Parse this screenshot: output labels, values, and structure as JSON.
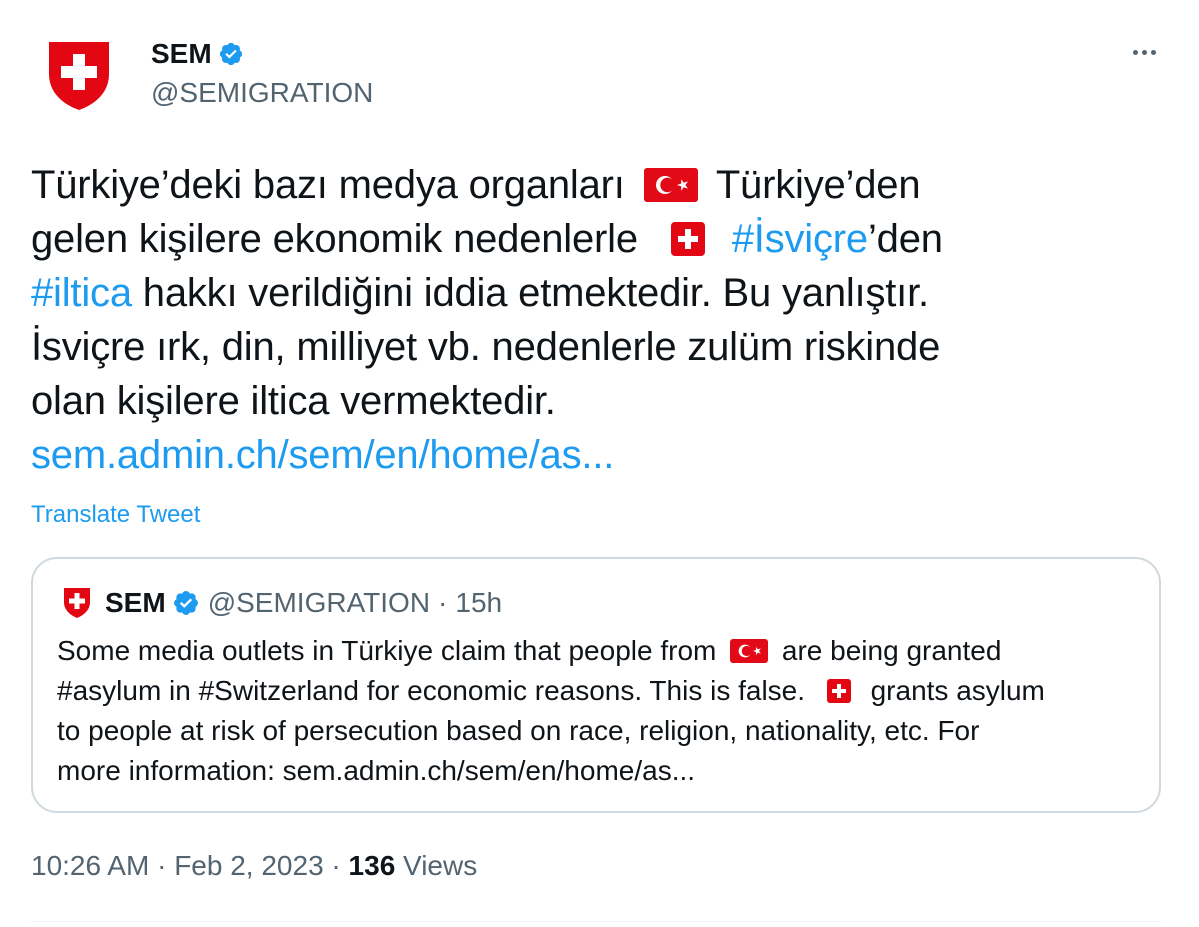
{
  "author": {
    "name": "SEM",
    "handle": "@SEMIGRATION",
    "avatar_icon": "swiss-shield-icon",
    "verified_icon": "verified-badge-icon"
  },
  "more_icon": "more-options-icon",
  "tweet": {
    "line1_a": "Türkiye’deki bazı medya organları",
    "line1_b": "Türkiye’den",
    "line2_a": "gelen kişilere ekonomik nedenlerle",
    "line2_hashtag": "#İsviçre",
    "line2_b": "’den",
    "line3_hashtag": "#iltica",
    "line3_b": " hakkı verildiğini iddia etmektedir. Bu yanlıştır.",
    "line4": "İsviçre ırk, din, milliyet vb. nedenlerle zulüm riskinde",
    "line5": "olan kişilere iltica vermektedir.",
    "link": "sem.admin.ch/sem/en/home/as..."
  },
  "translate_label": "Translate Tweet",
  "quoted_tweet": {
    "name": "SEM",
    "handle": "@SEMIGRATION",
    "separator": "·",
    "time": "15h",
    "line1_a": "Some media outlets in Türkiye claim that people from",
    "line1_b": "are being granted",
    "line2_a": "#asylum in #Switzerland for economic reasons. This is false.",
    "line2_b": "grants asylum",
    "line3": "to people at risk of persecution based on race, religion, nationality, etc. For",
    "line4": "more information: sem.admin.ch/sem/en/home/as..."
  },
  "meta": {
    "time": "10:26 AM",
    "sep1": " · ",
    "date": "Feb 2, 2023",
    "sep2": " · ",
    "views_count": "136",
    "views_label": " Views"
  },
  "colors": {
    "link": "#1d9bf0",
    "secondary_text": "#536471",
    "swiss_red": "#e30613",
    "turkey_red": "#e30a17",
    "border": "#cfd9de"
  }
}
